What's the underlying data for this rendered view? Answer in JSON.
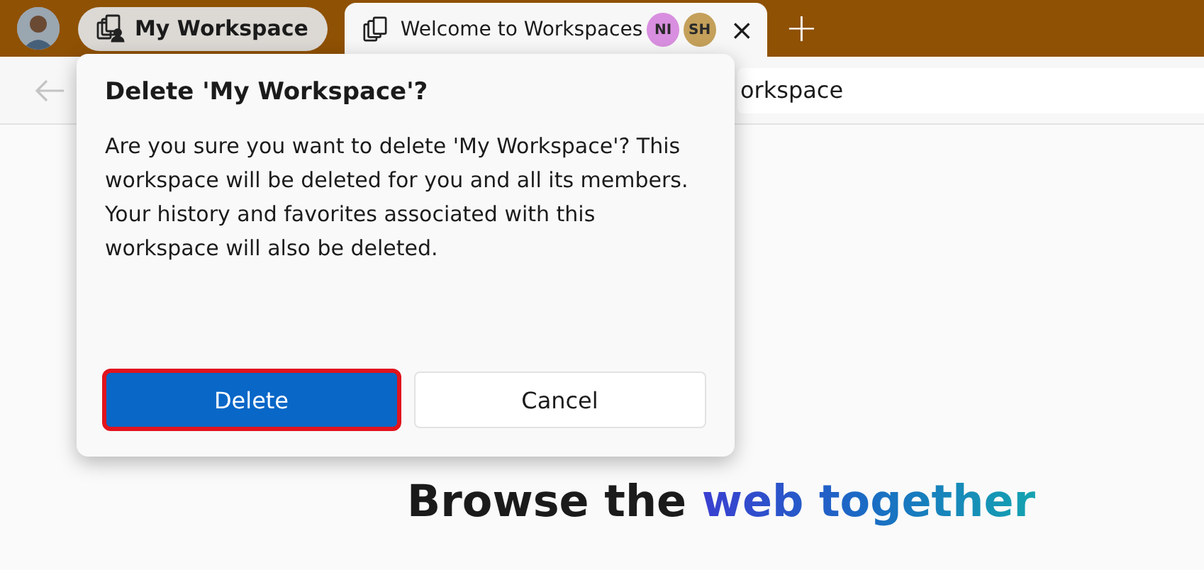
{
  "tab_bar": {
    "workspace_button": {
      "label": "My Workspace"
    },
    "tabs": [
      {
        "title": "Welcome to Workspaces",
        "selected": true,
        "members": [
          {
            "initials": "NI",
            "color": "#d88fdf"
          },
          {
            "initials": "SH",
            "color": "#c4a05a"
          }
        ],
        "close": "×"
      }
    ],
    "new_tab": "+"
  },
  "address_bar": {
    "value": "orkspace"
  },
  "dialog": {
    "title": "Delete 'My Workspace'?",
    "message": "Are you sure you want to delete 'My Workspace'? This workspace will be deleted for you and all its members. Your history and favorites associated with this workspace will also be deleted.",
    "buttons": [
      {
        "label": "Delete",
        "kind": "primary",
        "highlighted": true
      },
      {
        "label": "Cancel",
        "kind": "secondary",
        "highlighted": false
      }
    ]
  },
  "hero": {
    "lead": "Browse the",
    "accent": "web together"
  }
}
